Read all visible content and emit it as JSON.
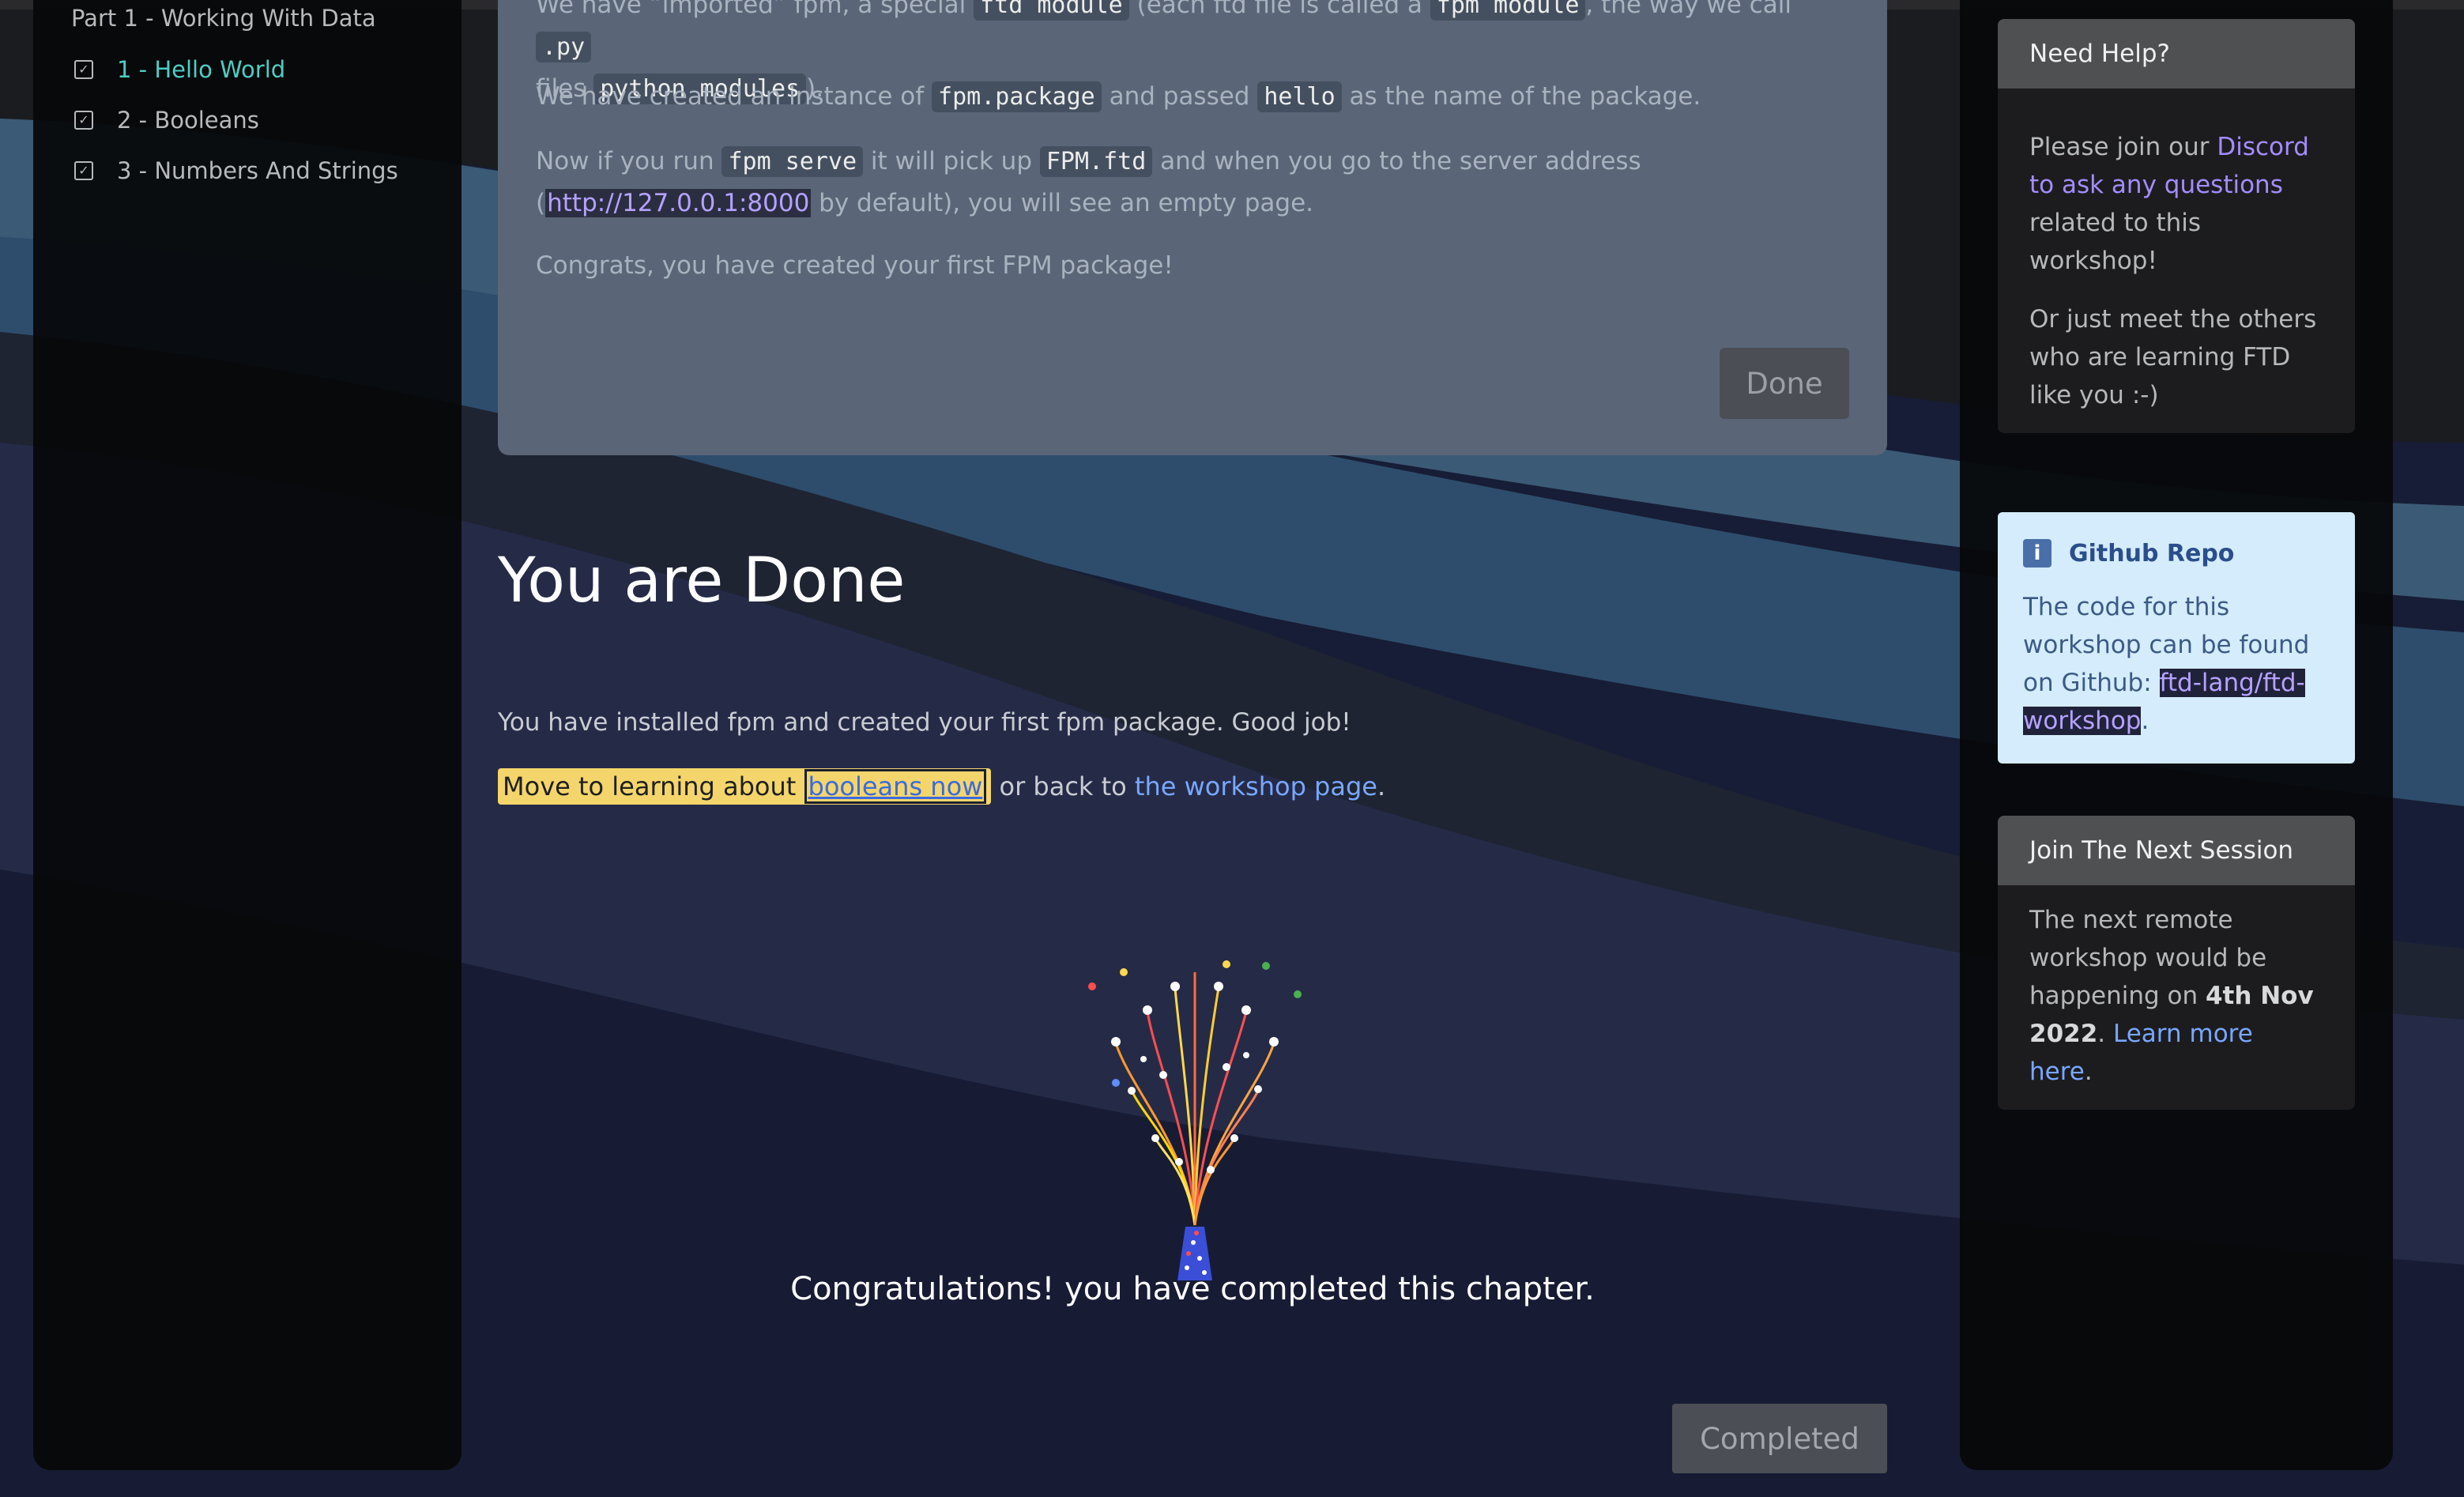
{
  "sidebar": {
    "part_title": "Part 1 - Working With Data",
    "items": [
      {
        "label": "1 - Hello World",
        "active": true
      },
      {
        "label": "2 - Booleans",
        "active": false
      },
      {
        "label": "3 - Numbers And Strings",
        "active": false
      }
    ]
  },
  "card": {
    "p1": {
      "a": "We have “imported” fpm, a special ",
      "c1": "ftd module",
      "b": " (each ftd file is called a ",
      "c2": "fpm module",
      ",": "",
      "d": ", the way we call ",
      "c3": ".py",
      "e": " files ",
      "c4": "python modules",
      "f": ")."
    },
    "p2": {
      "a": "We have created an instance of ",
      "c1": "fpm.package",
      "b": " and passed ",
      "c2": "hello",
      "c": " as the name of the package."
    },
    "p3": {
      "a": "Now if you run ",
      "c1": "fpm serve",
      "b": " it will pick up ",
      "c2": "FPM.ftd",
      "c": " and when you go to the server address (",
      "link": "http://127.0.0.1:8000",
      "d": " by default), you will see an empty page."
    },
    "p4": "Congrats, you have created your first FPM package!",
    "done_label": "Done"
  },
  "main": {
    "heading": "You are Done",
    "done_text": "You have installed fpm and created your first fpm package. Good job!",
    "nav": {
      "a": "Move to learning about ",
      "link1": "booleans now",
      "b": " or back to ",
      "link2": "the workshop page",
      "c": "."
    },
    "congrats": "Congratulations! you have completed this chapter.",
    "completed_label": "Completed"
  },
  "right": {
    "help": {
      "title": "Need Help?",
      "p1a": "Please join our ",
      "p1link": "Discord to ask any questions",
      "p1b": " related to this workshop!",
      "p2": "Or just meet the others who are learning FTD like you :-)"
    },
    "github": {
      "title": "Github Repo",
      "text": "The code for this workshop can be found on Github: ",
      "link": "ftd-lang/ftd-workshop",
      "end": "."
    },
    "session": {
      "title": "Join The Next Session",
      "text": "The next remote workshop would be happening on ",
      "date": "4th Nov 2022",
      "mid": ". ",
      "link": "Learn more here",
      "end": "."
    }
  },
  "colors": {
    "accent_teal": "#4ecdc4",
    "link_purple": "#a48cff",
    "link_blue": "#79a7ff",
    "highlight_yellow": "#f4d56b"
  }
}
